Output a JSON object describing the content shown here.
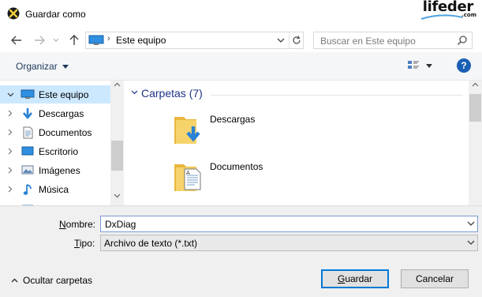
{
  "window": {
    "title": "Guardar como"
  },
  "watermark": {
    "brand": "lifeder",
    "suffix": ".com"
  },
  "nav": {
    "address_location": "Este equipo",
    "search_placeholder": "Buscar en Este equipo"
  },
  "toolbar": {
    "organize_label": "Organizar",
    "help_label": "?"
  },
  "sidebar": {
    "items": [
      {
        "label": "Este equipo",
        "icon": "pc-icon",
        "selected": true,
        "expanded": true
      },
      {
        "label": "Descargas",
        "icon": "download-arrow-icon"
      },
      {
        "label": "Documentos",
        "icon": "document-icon"
      },
      {
        "label": "Escritorio",
        "icon": "desktop-icon"
      },
      {
        "label": "Imágenes",
        "icon": "pictures-icon"
      },
      {
        "label": "Música",
        "icon": "music-note-icon"
      }
    ]
  },
  "main": {
    "group_label": "Carpetas (7)",
    "folders": [
      {
        "label": "Descargas",
        "icon": "downloads-folder-icon"
      },
      {
        "label": "Documentos",
        "icon": "documents-folder-icon"
      }
    ]
  },
  "fields": {
    "name_label_u": "N",
    "name_label_rest": "ombre:",
    "name_value": "DxDiag",
    "type_label_u": "T",
    "type_label_rest": "ipo:",
    "type_value": "Archivo de texto (*.txt)"
  },
  "footer": {
    "hide_folders_label": "Ocultar carpetas",
    "save_label_u": "G",
    "save_label_rest": "uardar",
    "cancel_label": "Cancelar"
  },
  "colors": {
    "selection": "#cce8ff",
    "accent": "#0078d7",
    "group_header": "#1e3287",
    "folder_yellow": "#f3c74f"
  }
}
